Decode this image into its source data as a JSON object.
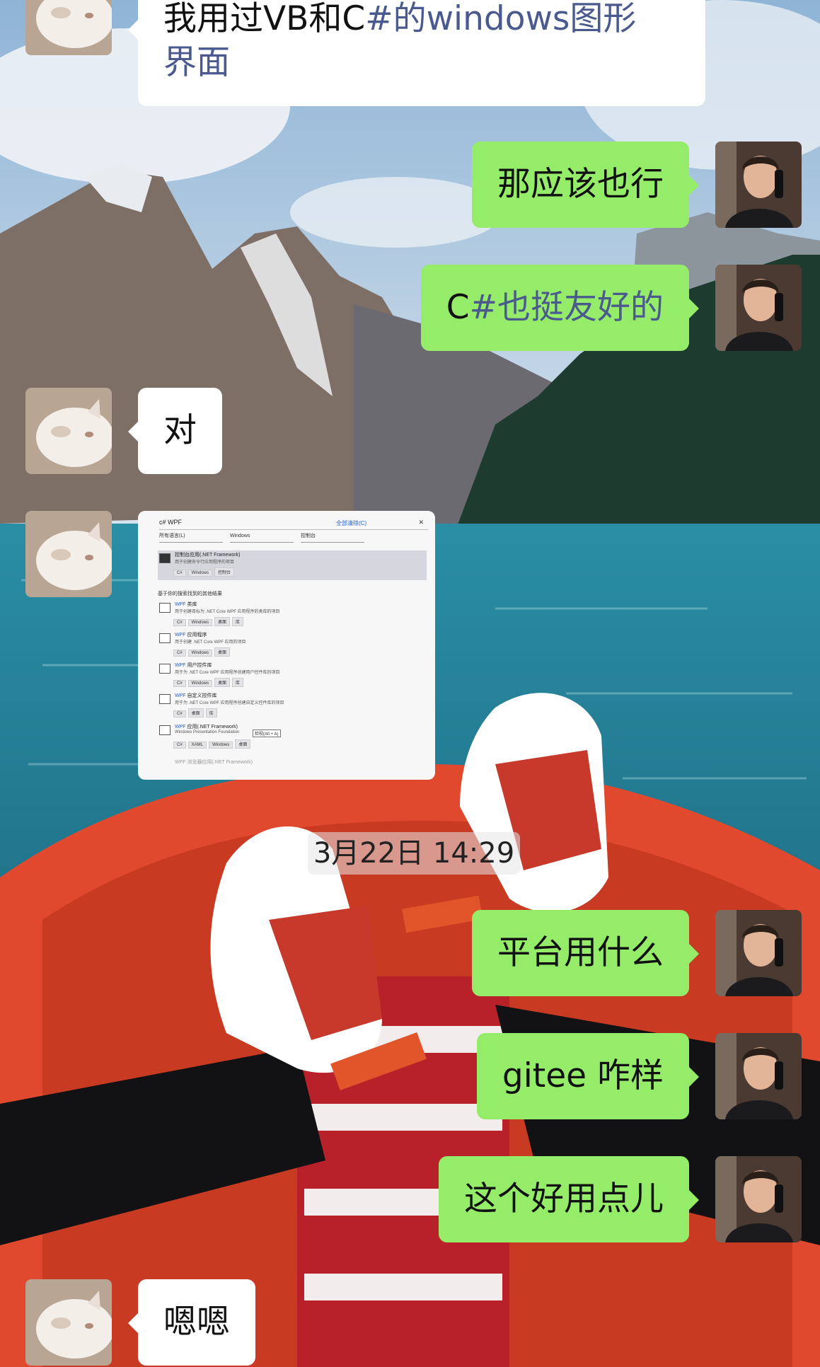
{
  "colors": {
    "bubble_outgoing": "#95ec69",
    "bubble_incoming": "#ffffff"
  },
  "avatars": {
    "left": "cat-avatar",
    "right": "man-on-phone-avatar"
  },
  "messages": [
    {
      "side": "left",
      "text_parts": [
        "我用过VB和C",
        "#的windows图形"
      ],
      "line2": "界面"
    },
    {
      "side": "right",
      "text": "那应该也行"
    },
    {
      "side": "right",
      "text_parts": [
        "C",
        "#也挺友好的"
      ]
    },
    {
      "side": "left",
      "text": "对"
    },
    {
      "side": "left",
      "type": "image"
    },
    {
      "side": "right",
      "text": "平台用什么"
    },
    {
      "side": "right",
      "text": "gitee 咋样"
    },
    {
      "side": "right",
      "text": "这个好用点儿"
    },
    {
      "side": "left",
      "text": "嗯嗯"
    }
  ],
  "timestamp": "3月22日 14:29",
  "shared_image": {
    "search_value": "c# WPF",
    "clear_all": "全部清除(C)",
    "filters": [
      "所有语言(L)",
      "Windows",
      "控制台"
    ],
    "selected_item": {
      "title": "控制台应用(.NET Framework)",
      "desc": "用于创建命令行应用程序的项目",
      "tags": [
        "C#",
        "Windows",
        "控制台"
      ]
    },
    "section_header": "基于你的搜索找到的其他结果",
    "items": [
      {
        "title_hl": "WPF",
        "title": " 类库",
        "desc": "用于创建目标为 .NET Core WPF 应用程序的类库的项目",
        "tags": [
          "C#",
          "Windows",
          "桌面",
          "库"
        ]
      },
      {
        "title_hl": "WPF",
        "title": " 应用程序",
        "desc": "用于创建 .NET Core WPF 应用的项目",
        "tags": [
          "C#",
          "Windows",
          "桌面"
        ]
      },
      {
        "title_hl": "WPF",
        "title": " 用户控件库",
        "desc": "用于为 .NET Core WPF 应用程序创建用户控件库的项目",
        "tags": [
          "C#",
          "Windows",
          "桌面",
          "库"
        ]
      },
      {
        "title_hl": "WPF",
        "title": " 自定义控件库",
        "desc": "用于为 .NET Core WPF 应用程序创建自定义控件库的项目",
        "tags": [
          "C#",
          "桌面",
          "库"
        ]
      },
      {
        "title_hl": "WPF",
        "title": " 应用(.NET Framework)",
        "desc": "Windows Presentation Foundation",
        "tags": [
          "C#",
          "XAML",
          "Windows",
          "桌面"
        ]
      }
    ],
    "tooltip": "检视(Alt + A)",
    "faded_item": "WPF 浏览器应用(.NET Framework)"
  }
}
